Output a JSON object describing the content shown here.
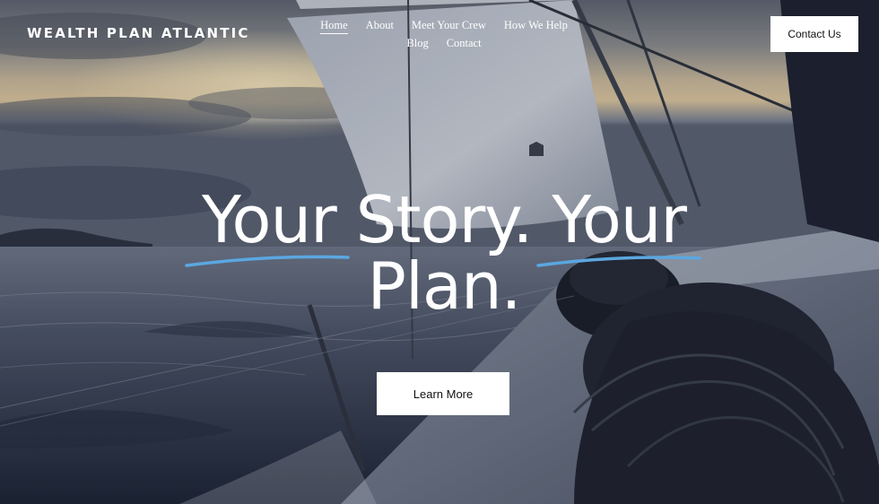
{
  "site": {
    "title": "WEALTH PLAN ATLANTIC"
  },
  "nav": {
    "items": [
      {
        "label": "Home",
        "active": true
      },
      {
        "label": "About",
        "active": false
      },
      {
        "label": "Meet Your Crew",
        "active": false
      },
      {
        "label": "How We Help",
        "active": false
      },
      {
        "label": "Blog",
        "active": false
      },
      {
        "label": "Contact",
        "active": false
      }
    ]
  },
  "header": {
    "contact_label": "Contact Us"
  },
  "hero": {
    "headline": "Your Story. Your Plan.",
    "cta_label": "Learn More",
    "background_icon": "sailboat-photo"
  },
  "colors": {
    "accent_underline": "#5ba7e0",
    "button_bg": "#ffffff",
    "button_text": "#111111",
    "text": "#ffffff"
  }
}
